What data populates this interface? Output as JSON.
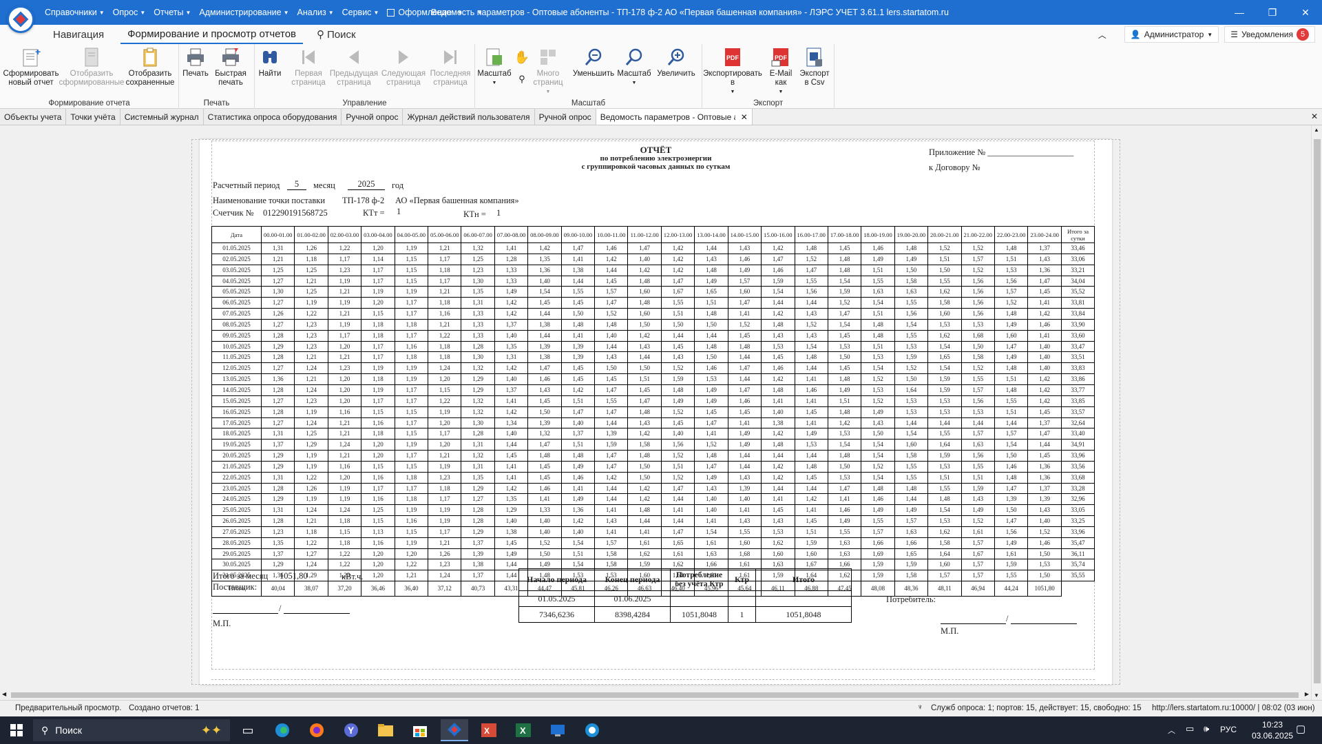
{
  "titlebar": {
    "menu": [
      "Справочники",
      "Опрос",
      "Отчеты",
      "Администрирование",
      "Анализ",
      "Сервис",
      "Оформление"
    ],
    "title": "Ведомость параметров - Оптовые абоненты - ТП-178 ф-2    АО «Первая башенная компания» - ЛЭРС УЧЕТ 3.61.1 lers.startatom.ru"
  },
  "ribbon_tabs": [
    "Навигация",
    "Формирование и просмотр отчетов",
    "Поиск"
  ],
  "ribbon_right": {
    "user": "Администратор",
    "notifications": "Уведомления",
    "count": "5"
  },
  "ribbon": {
    "groups": [
      "Формирование отчета",
      "Печать",
      "Управление",
      "Масштаб",
      "Экспорт"
    ],
    "buttons": {
      "new": "Сформировать новый отчет",
      "show_generated": "Отобразить сформированные",
      "show_saved": "Отобразить сохраненные",
      "print": "Печать",
      "quick_print": "Быстрая печать",
      "find": "Найти",
      "first": "Первая страница",
      "prev": "Предыдущая страница",
      "next": "Следующая страница",
      "last": "Последняя страница",
      "zoom_mode": "Масштаб",
      "many_pages": "Много страниц",
      "zoom_out": "Уменьшить",
      "zoom": "Масштаб",
      "zoom_in": "Увеличить",
      "export_to": "Экспортировать в",
      "email_as": "E-Mail как",
      "export_csv": "Экспорт в Csv"
    }
  },
  "doc_tabs": [
    "Объекты учета",
    "Точки учёта",
    "Системный журнал",
    "Статистика опроса оборудования",
    "Ручной опрос",
    "Журнал действий пользователя",
    "Ручной опрос",
    "Ведомость параметров - Оптовые а"
  ],
  "report": {
    "title1": "ОТЧЁТ",
    "title2": "по потреблению электроэнергии",
    "title3": "с группировкой часовых данных по суткам",
    "appendix": "Приложение № ____________________",
    "contract": "к Договору №",
    "period_label": "Расчетный период",
    "month_value": "5",
    "month_label": "месяц",
    "year_value": "2025",
    "year_label": "год",
    "point_label": "Наименование точки поставки",
    "point_value": "ТП-178 ф-2",
    "org_value": "АО «Первая башенная компания»",
    "meter_label": "Счетчик №",
    "meter_value": "012290191568725",
    "ktt_label": "КТт =",
    "ktt_value": "1",
    "ktn_label": "КТн =",
    "ktn_value": "1",
    "month_total_label": "Итого за месяц",
    "month_total_value": "1051,80",
    "unit": "кВт.ч.",
    "supplier": "Поставщик:",
    "consumer": "Потребитель:",
    "mp": "М.П.",
    "mp2": "М.П."
  },
  "grid": {
    "header": [
      "Дата",
      "00.00-01.00",
      "01.00-02.00",
      "02.00-03.00",
      "03.00-04.00",
      "04.00-05.00",
      "05.00-06.00",
      "06.00-07.00",
      "07.00-08.00",
      "08.00-09.00",
      "09.00-10.00",
      "10.00-11.00",
      "11.00-12.00",
      "12.00-13.00",
      "13.00-14.00",
      "14.00-15.00",
      "15.00-16.00",
      "16.00-17.00",
      "17.00-18.00",
      "18.00-19.00",
      "19.00-20.00",
      "20.00-21.00",
      "21.00-22.00",
      "22.00-23.00",
      "23.00-24.00",
      "Итого за сутки"
    ],
    "rows": [
      [
        "01.05.2025",
        "1,31",
        "1,26",
        "1,22",
        "1,20",
        "1,19",
        "1,21",
        "1,32",
        "1,41",
        "1,42",
        "1,47",
        "1,46",
        "1,47",
        "1,42",
        "1,44",
        "1,43",
        "1,42",
        "1,48",
        "1,45",
        "1,46",
        "1,48",
        "1,52",
        "1,52",
        "1,48",
        "1,37",
        "33,46"
      ],
      [
        "02.05.2025",
        "1,21",
        "1,18",
        "1,17",
        "1,14",
        "1,15",
        "1,17",
        "1,25",
        "1,28",
        "1,35",
        "1,41",
        "1,42",
        "1,40",
        "1,42",
        "1,43",
        "1,46",
        "1,47",
        "1,52",
        "1,48",
        "1,49",
        "1,49",
        "1,51",
        "1,57",
        "1,51",
        "1,43",
        "33,06"
      ],
      [
        "03.05.2025",
        "1,25",
        "1,25",
        "1,23",
        "1,17",
        "1,15",
        "1,18",
        "1,23",
        "1,33",
        "1,36",
        "1,38",
        "1,44",
        "1,42",
        "1,42",
        "1,48",
        "1,49",
        "1,46",
        "1,47",
        "1,48",
        "1,51",
        "1,50",
        "1,50",
        "1,52",
        "1,53",
        "1,36",
        "33,21"
      ],
      [
        "04.05.2025",
        "1,27",
        "1,21",
        "1,19",
        "1,17",
        "1,15",
        "1,17",
        "1,30",
        "1,33",
        "1,40",
        "1,44",
        "1,45",
        "1,48",
        "1,47",
        "1,49",
        "1,57",
        "1,59",
        "1,55",
        "1,54",
        "1,55",
        "1,58",
        "1,55",
        "1,56",
        "1,56",
        "1,47",
        "34,04"
      ],
      [
        "05.05.2025",
        "1,30",
        "1,25",
        "1,21",
        "1,19",
        "1,19",
        "1,21",
        "1,35",
        "1,49",
        "1,54",
        "1,55",
        "1,57",
        "1,60",
        "1,67",
        "1,65",
        "1,60",
        "1,54",
        "1,56",
        "1,59",
        "1,63",
        "1,63",
        "1,62",
        "1,56",
        "1,57",
        "1,45",
        "35,52"
      ],
      [
        "06.05.2025",
        "1,27",
        "1,19",
        "1,19",
        "1,20",
        "1,17",
        "1,18",
        "1,31",
        "1,42",
        "1,45",
        "1,45",
        "1,47",
        "1,48",
        "1,55",
        "1,51",
        "1,47",
        "1,44",
        "1,44",
        "1,52",
        "1,54",
        "1,55",
        "1,58",
        "1,56",
        "1,52",
        "1,41",
        "33,81"
      ],
      [
        "07.05.2025",
        "1,26",
        "1,22",
        "1,21",
        "1,15",
        "1,17",
        "1,16",
        "1,33",
        "1,42",
        "1,44",
        "1,50",
        "1,52",
        "1,60",
        "1,51",
        "1,48",
        "1,41",
        "1,42",
        "1,43",
        "1,47",
        "1,51",
        "1,56",
        "1,60",
        "1,56",
        "1,48",
        "1,42",
        "33,84"
      ],
      [
        "08.05.2025",
        "1,27",
        "1,23",
        "1,19",
        "1,18",
        "1,18",
        "1,21",
        "1,33",
        "1,37",
        "1,38",
        "1,48",
        "1,48",
        "1,50",
        "1,50",
        "1,50",
        "1,52",
        "1,48",
        "1,52",
        "1,54",
        "1,48",
        "1,54",
        "1,53",
        "1,53",
        "1,49",
        "1,46",
        "33,90"
      ],
      [
        "09.05.2025",
        "1,28",
        "1,23",
        "1,17",
        "1,18",
        "1,17",
        "1,22",
        "1,33",
        "1,40",
        "1,44",
        "1,41",
        "1,40",
        "1,42",
        "1,44",
        "1,44",
        "1,45",
        "1,43",
        "1,43",
        "1,45",
        "1,48",
        "1,55",
        "1,62",
        "1,68",
        "1,60",
        "1,41",
        "33,60"
      ],
      [
        "10.05.2025",
        "1,29",
        "1,23",
        "1,20",
        "1,17",
        "1,16",
        "1,18",
        "1,28",
        "1,35",
        "1,39",
        "1,39",
        "1,44",
        "1,43",
        "1,45",
        "1,48",
        "1,48",
        "1,53",
        "1,54",
        "1,53",
        "1,51",
        "1,53",
        "1,54",
        "1,50",
        "1,47",
        "1,40",
        "33,47"
      ],
      [
        "11.05.2025",
        "1,28",
        "1,21",
        "1,21",
        "1,17",
        "1,18",
        "1,18",
        "1,30",
        "1,31",
        "1,38",
        "1,39",
        "1,43",
        "1,44",
        "1,43",
        "1,50",
        "1,44",
        "1,45",
        "1,48",
        "1,50",
        "1,53",
        "1,59",
        "1,65",
        "1,58",
        "1,49",
        "1,40",
        "33,51"
      ],
      [
        "12.05.2025",
        "1,27",
        "1,24",
        "1,23",
        "1,19",
        "1,19",
        "1,24",
        "1,32",
        "1,42",
        "1,47",
        "1,45",
        "1,50",
        "1,50",
        "1,52",
        "1,46",
        "1,47",
        "1,46",
        "1,44",
        "1,45",
        "1,54",
        "1,52",
        "1,54",
        "1,52",
        "1,48",
        "1,40",
        "33,83"
      ],
      [
        "13.05.2025",
        "1,36",
        "1,21",
        "1,20",
        "1,18",
        "1,19",
        "1,20",
        "1,29",
        "1,40",
        "1,46",
        "1,45",
        "1,45",
        "1,51",
        "1,59",
        "1,53",
        "1,44",
        "1,42",
        "1,41",
        "1,48",
        "1,52",
        "1,50",
        "1,59",
        "1,55",
        "1,51",
        "1,42",
        "33,86"
      ],
      [
        "14.05.2025",
        "1,28",
        "1,24",
        "1,20",
        "1,19",
        "1,17",
        "1,15",
        "1,29",
        "1,37",
        "1,43",
        "1,42",
        "1,47",
        "1,45",
        "1,48",
        "1,49",
        "1,47",
        "1,48",
        "1,46",
        "1,49",
        "1,53",
        "1,64",
        "1,59",
        "1,57",
        "1,48",
        "1,42",
        "33,77"
      ],
      [
        "15.05.2025",
        "1,27",
        "1,23",
        "1,20",
        "1,17",
        "1,17",
        "1,22",
        "1,32",
        "1,41",
        "1,45",
        "1,51",
        "1,55",
        "1,47",
        "1,49",
        "1,49",
        "1,46",
        "1,41",
        "1,41",
        "1,51",
        "1,52",
        "1,53",
        "1,53",
        "1,56",
        "1,55",
        "1,42",
        "33,85"
      ],
      [
        "16.05.2025",
        "1,28",
        "1,19",
        "1,16",
        "1,15",
        "1,15",
        "1,19",
        "1,32",
        "1,42",
        "1,50",
        "1,47",
        "1,47",
        "1,48",
        "1,52",
        "1,45",
        "1,45",
        "1,40",
        "1,45",
        "1,48",
        "1,49",
        "1,53",
        "1,53",
        "1,53",
        "1,51",
        "1,45",
        "33,57"
      ],
      [
        "17.05.2025",
        "1,27",
        "1,24",
        "1,21",
        "1,16",
        "1,17",
        "1,20",
        "1,30",
        "1,34",
        "1,39",
        "1,40",
        "1,44",
        "1,43",
        "1,45",
        "1,47",
        "1,41",
        "1,38",
        "1,41",
        "1,42",
        "1,43",
        "1,44",
        "1,44",
        "1,44",
        "1,44",
        "1,37",
        "32,64"
      ],
      [
        "18.05.2025",
        "1,31",
        "1,25",
        "1,21",
        "1,18",
        "1,15",
        "1,17",
        "1,28",
        "1,40",
        "1,32",
        "1,37",
        "1,39",
        "1,42",
        "1,40",
        "1,41",
        "1,49",
        "1,42",
        "1,49",
        "1,53",
        "1,50",
        "1,54",
        "1,55",
        "1,57",
        "1,57",
        "1,47",
        "33,40"
      ],
      [
        "19.05.2025",
        "1,37",
        "1,29",
        "1,24",
        "1,20",
        "1,19",
        "1,20",
        "1,31",
        "1,44",
        "1,47",
        "1,51",
        "1,59",
        "1,58",
        "1,56",
        "1,52",
        "1,49",
        "1,48",
        "1,53",
        "1,54",
        "1,54",
        "1,60",
        "1,64",
        "1,63",
        "1,54",
        "1,44",
        "34,91"
      ],
      [
        "20.05.2025",
        "1,29",
        "1,19",
        "1,21",
        "1,20",
        "1,17",
        "1,21",
        "1,32",
        "1,45",
        "1,48",
        "1,48",
        "1,47",
        "1,48",
        "1,52",
        "1,48",
        "1,44",
        "1,44",
        "1,44",
        "1,48",
        "1,54",
        "1,58",
        "1,59",
        "1,56",
        "1,50",
        "1,45",
        "33,96"
      ],
      [
        "21.05.2025",
        "1,29",
        "1,19",
        "1,16",
        "1,15",
        "1,15",
        "1,19",
        "1,31",
        "1,41",
        "1,45",
        "1,49",
        "1,47",
        "1,50",
        "1,51",
        "1,47",
        "1,44",
        "1,42",
        "1,48",
        "1,50",
        "1,52",
        "1,55",
        "1,53",
        "1,55",
        "1,46",
        "1,36",
        "33,56"
      ],
      [
        "22.05.2025",
        "1,31",
        "1,22",
        "1,20",
        "1,16",
        "1,18",
        "1,23",
        "1,35",
        "1,41",
        "1,45",
        "1,46",
        "1,42",
        "1,50",
        "1,52",
        "1,49",
        "1,43",
        "1,42",
        "1,45",
        "1,53",
        "1,54",
        "1,55",
        "1,51",
        "1,51",
        "1,48",
        "1,36",
        "33,68"
      ],
      [
        "23.05.2025",
        "1,28",
        "1,26",
        "1,19",
        "1,17",
        "1,17",
        "1,18",
        "1,29",
        "1,42",
        "1,46",
        "1,41",
        "1,44",
        "1,42",
        "1,47",
        "1,43",
        "1,39",
        "1,44",
        "1,44",
        "1,47",
        "1,48",
        "1,48",
        "1,55",
        "1,59",
        "1,47",
        "1,37",
        "33,28"
      ],
      [
        "24.05.2025",
        "1,29",
        "1,19",
        "1,19",
        "1,16",
        "1,18",
        "1,17",
        "1,27",
        "1,35",
        "1,41",
        "1,49",
        "1,44",
        "1,42",
        "1,44",
        "1,40",
        "1,40",
        "1,41",
        "1,42",
        "1,41",
        "1,46",
        "1,44",
        "1,48",
        "1,43",
        "1,39",
        "1,39",
        "32,96"
      ],
      [
        "25.05.2025",
        "1,31",
        "1,24",
        "1,24",
        "1,25",
        "1,19",
        "1,19",
        "1,28",
        "1,29",
        "1,33",
        "1,36",
        "1,41",
        "1,48",
        "1,41",
        "1,40",
        "1,41",
        "1,45",
        "1,41",
        "1,46",
        "1,49",
        "1,49",
        "1,54",
        "1,49",
        "1,50",
        "1,43",
        "33,05"
      ],
      [
        "26.05.2025",
        "1,28",
        "1,21",
        "1,18",
        "1,15",
        "1,16",
        "1,19",
        "1,28",
        "1,40",
        "1,40",
        "1,42",
        "1,43",
        "1,44",
        "1,44",
        "1,41",
        "1,43",
        "1,43",
        "1,45",
        "1,49",
        "1,55",
        "1,57",
        "1,53",
        "1,52",
        "1,47",
        "1,40",
        "33,25"
      ],
      [
        "27.05.2025",
        "1,23",
        "1,18",
        "1,15",
        "1,13",
        "1,15",
        "1,17",
        "1,29",
        "1,38",
        "1,40",
        "1,40",
        "1,41",
        "1,41",
        "1,47",
        "1,54",
        "1,55",
        "1,53",
        "1,51",
        "1,55",
        "1,57",
        "1,63",
        "1,62",
        "1,61",
        "1,56",
        "1,52",
        "33,96"
      ],
      [
        "28.05.2025",
        "1,35",
        "1,22",
        "1,18",
        "1,16",
        "1,19",
        "1,21",
        "1,37",
        "1,45",
        "1,52",
        "1,54",
        "1,57",
        "1,61",
        "1,65",
        "1,61",
        "1,60",
        "1,62",
        "1,59",
        "1,63",
        "1,66",
        "1,66",
        "1,58",
        "1,57",
        "1,49",
        "1,46",
        "35,47"
      ],
      [
        "29.05.2025",
        "1,37",
        "1,27",
        "1,22",
        "1,20",
        "1,20",
        "1,26",
        "1,39",
        "1,49",
        "1,50",
        "1,51",
        "1,58",
        "1,62",
        "1,61",
        "1,63",
        "1,68",
        "1,60",
        "1,60",
        "1,63",
        "1,69",
        "1,65",
        "1,64",
        "1,67",
        "1,61",
        "1,50",
        "36,11"
      ],
      [
        "30.05.2025",
        "1,29",
        "1,24",
        "1,22",
        "1,20",
        "1,22",
        "1,23",
        "1,38",
        "1,44",
        "1,49",
        "1,54",
        "1,58",
        "1,59",
        "1,62",
        "1,66",
        "1,61",
        "1,63",
        "1,67",
        "1,66",
        "1,59",
        "1,59",
        "1,60",
        "1,57",
        "1,59",
        "1,53",
        "35,74"
      ],
      [
        "31.05.2025",
        "1,36",
        "1,29",
        "1,23",
        "1,20",
        "1,21",
        "1,24",
        "1,37",
        "1,44",
        "1,48",
        "1,53",
        "1,53",
        "1,60",
        "1,64",
        "1,61",
        "1,61",
        "1,59",
        "1,64",
        "1,62",
        "1,59",
        "1,58",
        "1,57",
        "1,57",
        "1,55",
        "1,50",
        "35,55"
      ]
    ],
    "total": [
      "Итого",
      "40,04",
      "38,07",
      "37,20",
      "36,46",
      "36,40",
      "37,12",
      "40,73",
      "43,31",
      "44,47",
      "45,81",
      "46,26",
      "46,63",
      "46,40",
      "45,96",
      "45,64",
      "46,11",
      "46,88",
      "47,45",
      "48,08",
      "48,36",
      "48,11",
      "46,94",
      "44,24",
      "1051,80"
    ]
  },
  "summary": {
    "headers": [
      "Начало периода",
      "Конец периода",
      "Потребление без учёта Ктр",
      "Ктр",
      "Итого"
    ],
    "row1": [
      "01.05.2025",
      "01.06.2025",
      "",
      "",
      ""
    ],
    "row2": [
      "7346,6236",
      "8398,4284",
      "1051,8048",
      "1",
      "1051,8048"
    ]
  },
  "status": {
    "left1": "Предварительный просмотр.",
    "left2": "Создано отчетов: 1",
    "services": "Служб опроса: 1; портов: 15, действует: 15, свободно: 15",
    "server": "http://lers.startatom.ru:10000/ | 08:02 (03 июн)"
  },
  "taskbar": {
    "search": "Поиск",
    "lang": "РУС",
    "time": "10:23",
    "date": "03.06.2025"
  }
}
